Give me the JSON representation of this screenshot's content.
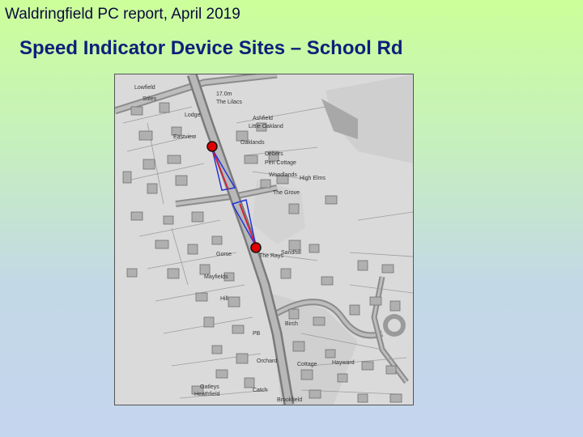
{
  "header": {
    "title": "Waldringfield PC report, April 2019"
  },
  "slide": {
    "title": "Speed Indicator Device Sites – School Rd"
  },
  "map": {
    "labels": {
      "lowfield": "Lowfield",
      "stiles": "Stiles",
      "lodge": "Lodge",
      "elevation": "17.0m",
      "lilacs": "The Lilacs",
      "ashfield": "Ashfield",
      "little_oakland": "Little Oakland",
      "eastview": "Eastview",
      "oaklands": "Oaklands",
      "debers": "Debers",
      "pen_cottage": "Pen Cottage",
      "woodlands": "Woodlands",
      "high_elms": "High Elms",
      "the_grove": "The Grove",
      "sandhill": "Sandhill",
      "the_rays": "The Rays",
      "gorse": "Gorse",
      "mayfields": "Mayfields",
      "hill": "Hill",
      "birch": "Birch",
      "cottage": "Cottage",
      "hayward": "Hayward",
      "pb": "PB",
      "orchard": "Orchard",
      "brookfield": "Brookfield",
      "oatleys": "Oatleys",
      "heathfield": "Heathfield",
      "catch": "Catch"
    },
    "colors": {
      "marker": "#e00000",
      "marker_stroke": "#111111",
      "zone": "#2233dd",
      "road": "#8c8c8c"
    }
  }
}
